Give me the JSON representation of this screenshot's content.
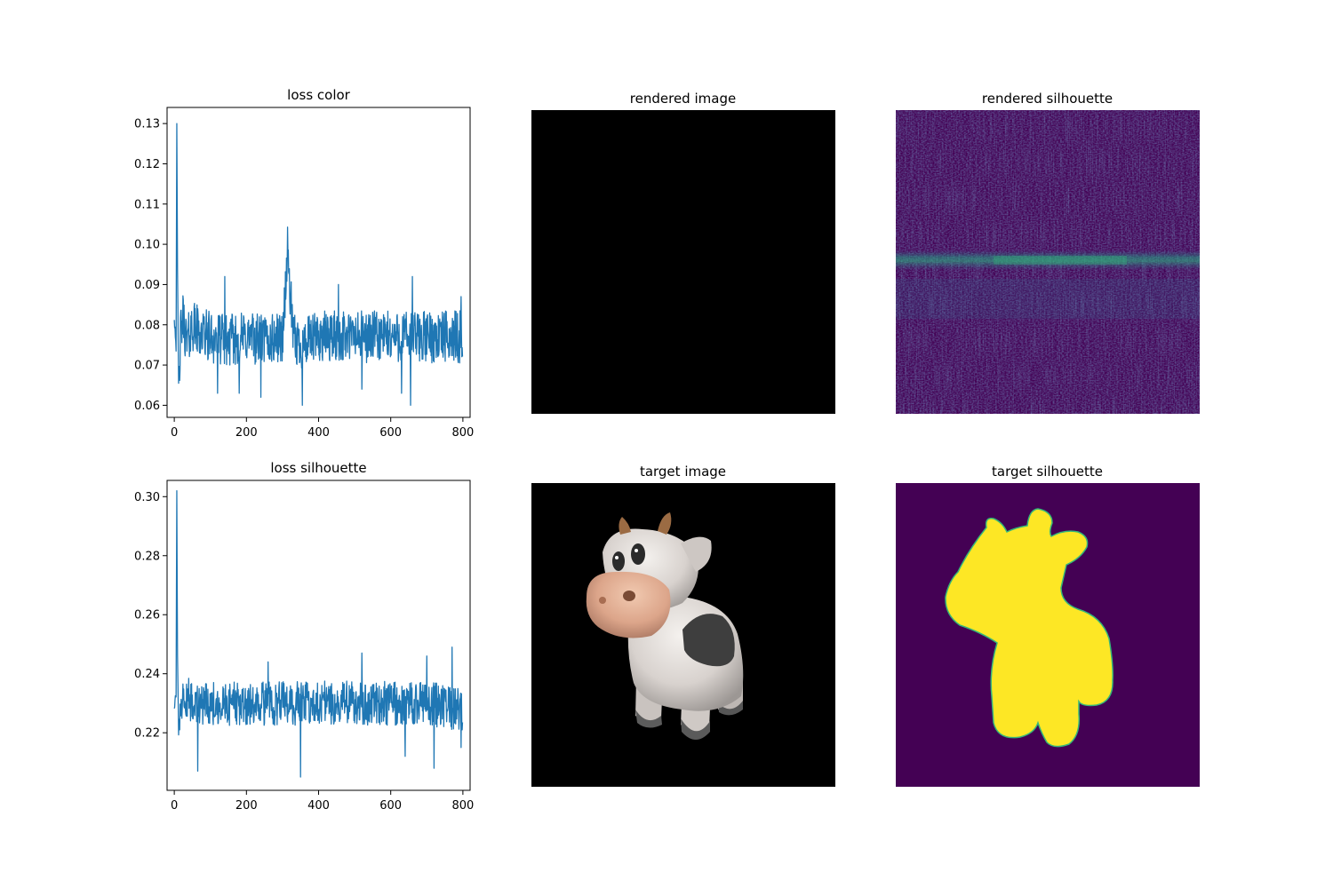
{
  "figure": {
    "colors": {
      "line": "#1f77b4",
      "axes": "#000000",
      "background": "#ffffff",
      "black_panel": "#000000",
      "viridis_low": "#440154",
      "viridis_high": "#fde725",
      "viridis_mid": "#21918c"
    }
  },
  "chart_data": [
    {
      "type": "line",
      "title": "loss color",
      "xlabel": "",
      "ylabel": "",
      "xlim": [
        -20,
        820
      ],
      "ylim": [
        0.057,
        0.134
      ],
      "x_ticks": [
        0,
        200,
        400,
        600,
        800
      ],
      "x_tick_labels": [
        "0",
        "200",
        "400",
        "600",
        "800"
      ],
      "y_ticks": [
        0.06,
        0.07,
        0.08,
        0.09,
        0.1,
        0.11,
        0.12,
        0.13
      ],
      "y_tick_labels": [
        "0.06",
        "0.07",
        "0.08",
        "0.09",
        "0.10",
        "0.11",
        "0.12",
        "0.13"
      ],
      "grid": false,
      "series": [
        {
          "n_points": 800,
          "anchors": [
            [
              0,
              0.082
            ],
            [
              5,
              0.075
            ],
            [
              7,
              0.13
            ],
            [
              9,
              0.092
            ],
            [
              12,
              0.065
            ],
            [
              18,
              0.078
            ],
            [
              25,
              0.082
            ],
            [
              35,
              0.075
            ],
            [
              50,
              0.08
            ],
            [
              70,
              0.078
            ],
            [
              100,
              0.077
            ],
            [
              150,
              0.076
            ],
            [
              200,
              0.077
            ],
            [
              260,
              0.076
            ],
            [
              300,
              0.077
            ],
            [
              314,
              0.098
            ],
            [
              330,
              0.076
            ],
            [
              360,
              0.075
            ],
            [
              400,
              0.077
            ],
            [
              450,
              0.077
            ],
            [
              500,
              0.077
            ],
            [
              550,
              0.077
            ],
            [
              600,
              0.077
            ],
            [
              650,
              0.077
            ],
            [
              700,
              0.077
            ],
            [
              750,
              0.077
            ],
            [
              800,
              0.077
            ]
          ],
          "noise": 0.0065,
          "spikes": [
            [
              140,
              0.092
            ],
            [
              120,
              0.063
            ],
            [
              180,
              0.063
            ],
            [
              240,
              0.062
            ],
            [
              315,
              0.098
            ],
            [
              355,
              0.06
            ],
            [
              455,
              0.09
            ],
            [
              520,
              0.064
            ],
            [
              630,
              0.063
            ],
            [
              655,
              0.06
            ],
            [
              660,
              0.092
            ],
            [
              795,
              0.087
            ]
          ]
        }
      ]
    },
    {
      "type": "line",
      "title": "loss silhouette",
      "xlabel": "",
      "ylabel": "",
      "xlim": [
        -20,
        820
      ],
      "ylim": [
        0.2005,
        0.3055
      ],
      "x_ticks": [
        0,
        200,
        400,
        600,
        800
      ],
      "x_tick_labels": [
        "0",
        "200",
        "400",
        "600",
        "800"
      ],
      "y_ticks": [
        0.22,
        0.24,
        0.26,
        0.28,
        0.3
      ],
      "y_tick_labels": [
        "0.22",
        "0.24",
        "0.26",
        "0.28",
        "0.30"
      ],
      "grid": false,
      "series": [
        {
          "n_points": 800,
          "anchors": [
            [
              0,
              0.229
            ],
            [
              5,
              0.232
            ],
            [
              7,
              0.302
            ],
            [
              9,
              0.245
            ],
            [
              12,
              0.22
            ],
            [
              18,
              0.232
            ],
            [
              30,
              0.232
            ],
            [
              60,
              0.23
            ],
            [
              100,
              0.23
            ],
            [
              200,
              0.23
            ],
            [
              300,
              0.23
            ],
            [
              400,
              0.23
            ],
            [
              500,
              0.23
            ],
            [
              600,
              0.23
            ],
            [
              700,
              0.23
            ],
            [
              800,
              0.228
            ]
          ],
          "noise": 0.0075,
          "spikes": [
            [
              65,
              0.207
            ],
            [
              260,
              0.244
            ],
            [
              350,
              0.205
            ],
            [
              520,
              0.247
            ],
            [
              640,
              0.212
            ],
            [
              700,
              0.246
            ],
            [
              720,
              0.208
            ],
            [
              770,
              0.249
            ],
            [
              795,
              0.215
            ]
          ]
        }
      ]
    },
    {
      "type": "heatmap",
      "title": "rendered image",
      "colormap": "rgb",
      "content": "solid black image"
    },
    {
      "type": "heatmap",
      "title": "rendered silhouette",
      "colormap": "viridis",
      "content": "mostly low noise with a bright horizontal band about 50% down"
    },
    {
      "type": "heatmap",
      "title": "target image",
      "colormap": "rgb",
      "content": "rendered cow toy on black background"
    },
    {
      "type": "heatmap",
      "title": "target silhouette",
      "colormap": "viridis",
      "content": "yellow cow-shaped mask on dark purple background"
    }
  ]
}
